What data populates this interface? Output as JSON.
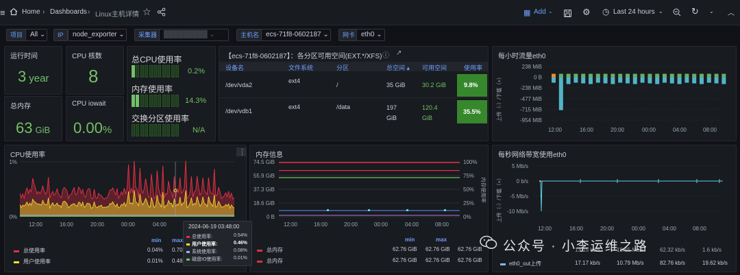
{
  "topbar": {
    "crumbs": [
      "Home",
      "Dashboards",
      "Linux主机详情"
    ],
    "add_label": "Add",
    "time_range": "Last 24 hours"
  },
  "variables": [
    {
      "label": "项目",
      "value": "All"
    },
    {
      "label": "IP",
      "value": "node_exporter"
    },
    {
      "label": "采集器",
      "value": "█████████"
    },
    {
      "label": "主机名",
      "value": "ecs-71f8-0602187"
    },
    {
      "label": "网卡",
      "value": "eth0"
    }
  ],
  "stats": {
    "uptime": {
      "title": "运行时间",
      "value": "3",
      "unit": "year"
    },
    "cpu_cores": {
      "title": "CPU 核数",
      "value": "8"
    },
    "total_mem": {
      "title": "总内存",
      "value": "63",
      "unit": "GiB"
    },
    "cpu_iowait": {
      "title": "CPU iowait",
      "value": "0.00",
      "unit": "%"
    }
  },
  "gauges": [
    {
      "label": "总CPU使用率",
      "value": "0.2%",
      "level": 0.002
    },
    {
      "label": "内存使用率",
      "value": "14.3%",
      "level": 0.143
    },
    {
      "label": "交换分区使用率",
      "value": "N/A",
      "level": 0
    }
  ],
  "disk_table": {
    "title": "【ecs-71f8-0602187】：各分区可用空间(EXT.*/XFS)",
    "headers": [
      "设备名",
      "文件系统",
      "分区",
      "总空间 ▴",
      "可用空间",
      "使用率"
    ],
    "rows": [
      {
        "device": "/dev/vda2",
        "fs": "ext4",
        "mount": "/",
        "total": "35 GiB",
        "avail": "30.2 GiB",
        "usage": "9.8%"
      },
      {
        "device": "/dev/vdb1",
        "fs": "ext4",
        "mount": "/data",
        "total": "197 GiB",
        "avail": "120.4 GiB",
        "usage": "35.5%"
      }
    ]
  },
  "traffic_hourly": {
    "title": "每小时流量eth0",
    "ylabel": "上传（-）/下载（+）",
    "yticks": [
      "238 MiB",
      "0 B",
      "-238 MiB",
      "-477 MiB",
      "-715 MiB",
      "-954 MiB"
    ],
    "xticks": [
      "12:00",
      "16:00",
      "20:00",
      "00:00",
      "04:00",
      "08:00"
    ]
  },
  "cpu_chart": {
    "title": "CPU使用率",
    "yticks": [
      "1%",
      "0%"
    ],
    "xticks": [
      "12:00",
      "16:00",
      "20:00",
      "00:00",
      "04:00",
      "08:00"
    ],
    "legend_headers": [
      "min",
      "max"
    ],
    "legend": [
      {
        "name": "总使用率",
        "min": "0.04%",
        "max": "0.70",
        "color": "#e02f44"
      },
      {
        "name": "用户使用率",
        "min": "0.01%",
        "max": "0.48",
        "color": "#fade2a"
      }
    ]
  },
  "tooltip": {
    "time": "2024-06-19 03:48:00",
    "rows": [
      {
        "name": "总使用率:",
        "value": "0.54%",
        "color": "#e02f44",
        "bold": false
      },
      {
        "name": "用户使用率:",
        "value": "0.46%",
        "color": "#fade2a",
        "bold": true
      },
      {
        "name": "系统使用率:",
        "value": "0.08%",
        "color": "#8ab8ff",
        "bold": false
      },
      {
        "name": "磁盘IO使用率:",
        "value": "0.01%",
        "color": "#73bf69",
        "bold": false
      }
    ]
  },
  "mem_chart": {
    "title": "内存信息",
    "yticks_left": [
      "74.5 GiB",
      "55.9 GiB",
      "37.3 GiB",
      "18.6 GiB",
      "0 B"
    ],
    "yticks_right": [
      "100%",
      "75%",
      "50%",
      "25%",
      "0%"
    ],
    "ylabel_right": "内存使用率",
    "xticks": [
      "12:00",
      "16:00",
      "20:00",
      "00:00",
      "04:00",
      "08:00"
    ],
    "legend_headers": [
      "min",
      "max"
    ],
    "legend": [
      {
        "name": "总内存",
        "min": "62.76 GiB",
        "max": "62.76 GiB",
        "last": "62.76 GiB",
        "color": "#e02f44"
      },
      {
        "name": "总内存",
        "min": "62.76 GiB",
        "max": "62.76 GiB",
        "last": "62.76 GiB",
        "color": "#e02f44"
      }
    ]
  },
  "net_chart": {
    "title": "每秒网络带宽使用eth0",
    "ylabel": "上传（-）/下载（+）",
    "yticks": [
      "5 Mb/s",
      "0 b/s",
      "-5 Mb/s",
      "-10 Mb/s"
    ],
    "xticks": [
      "12:00",
      "16:00",
      "20:00",
      "00:00",
      "04:00",
      "08:00"
    ],
    "legend": [
      {
        "name": "eth0_out上传",
        "v1": "17.17 kb/s",
        "v2": "10.79 Mb/s",
        "v3": "82.76 kb/s",
        "v4": "19.62 kb/s",
        "color": "#8ab8ff"
      }
    ],
    "partial_row": [
      "13.15 kb/s",
      "19.65 Mb/s",
      "62.32 kb/s",
      "1.6 kb/s"
    ]
  },
  "watermark": "公众号 · 小李运维之路"
}
